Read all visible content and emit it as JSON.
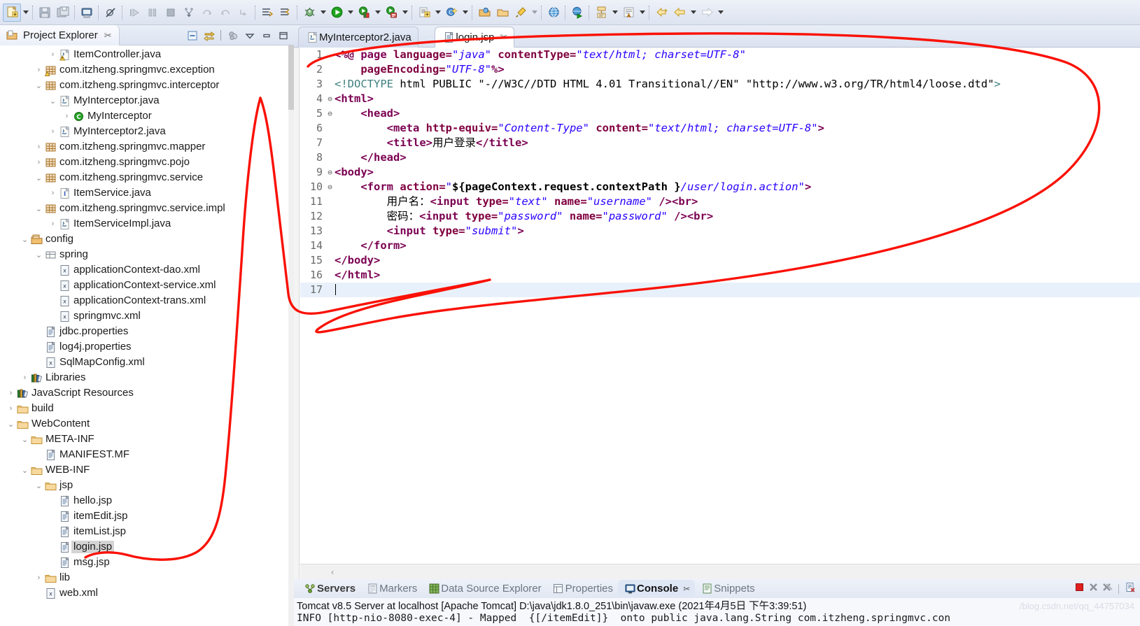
{
  "toolbar": {
    "buttons": [
      {
        "name": "new-wizard",
        "icon": "new-file-icon",
        "selected": true
      },
      {
        "name": "new-dropdown",
        "icon": "chevron-down-icon",
        "arrow": true
      },
      {
        "name": "save",
        "icon": "save-icon"
      },
      {
        "name": "save-all",
        "icon": "save-all-icon"
      },
      {
        "name": "print",
        "icon": "print-icon"
      },
      {
        "name": "toggle-breakpoint",
        "icon": "skip-breakpoints-icon"
      },
      {
        "name": "resume",
        "icon": "resume-icon"
      },
      {
        "name": "suspend",
        "icon": "suspend-icon"
      },
      {
        "name": "terminate",
        "icon": "terminate-icon"
      },
      {
        "name": "step-into",
        "icon": "step-into-icon"
      },
      {
        "name": "step-over",
        "icon": "step-over-icon"
      },
      {
        "name": "step-return",
        "icon": "step-return-icon"
      },
      {
        "name": "drop-to-frame",
        "icon": "drop-to-frame-icon"
      },
      {
        "name": "next-annotation",
        "icon": "next-annotation-icon"
      },
      {
        "name": "previous-annotation",
        "icon": "previous-annotation-icon"
      },
      {
        "name": "debug",
        "icon": "debug-bug-icon"
      },
      {
        "name": "run",
        "icon": "run-play-icon"
      },
      {
        "name": "run-external-tools",
        "icon": "external-tools-icon"
      },
      {
        "name": "run-server",
        "icon": "server-run-icon"
      },
      {
        "name": "new-java-project",
        "icon": "new-java-project-icon"
      },
      {
        "name": "new-class",
        "icon": "new-class-icon"
      },
      {
        "name": "open-type",
        "icon": "open-type-icon"
      },
      {
        "name": "search",
        "icon": "search-icon"
      },
      {
        "name": "open-task",
        "icon": "open-task-icon"
      },
      {
        "name": "web-browser",
        "icon": "globe-icon"
      },
      {
        "name": "web-preview",
        "icon": "globe-run-icon"
      },
      {
        "name": "new-jsp",
        "icon": "new-jsp-icon"
      },
      {
        "name": "new-html",
        "icon": "new-html-icon"
      },
      {
        "name": "back",
        "icon": "back-arrow-icon"
      },
      {
        "name": "forward",
        "icon": "forward-arrow-icon"
      }
    ]
  },
  "explorer": {
    "title": "Project Explorer",
    "close_glyph": "✂",
    "tools": [
      {
        "name": "collapse-all-icon"
      },
      {
        "name": "link-with-editor-icon"
      },
      {
        "name": "focus-on-active-task-icon"
      },
      {
        "name": "view-menu-icon"
      },
      {
        "name": "minimize-icon"
      },
      {
        "name": "maximize-icon"
      }
    ],
    "tree": [
      {
        "indent": 3,
        "twist": "collapsed",
        "icon": "java-file-warning-icon",
        "label": "ItemController.java"
      },
      {
        "indent": 2,
        "twist": "collapsed",
        "icon": "package-warning-icon",
        "label": "com.itzheng.springmvc.exception"
      },
      {
        "indent": 2,
        "twist": "expanded",
        "icon": "package-icon",
        "label": "com.itzheng.springmvc.interceptor"
      },
      {
        "indent": 3,
        "twist": "expanded",
        "icon": "java-file-icon",
        "label": "MyInterceptor.java"
      },
      {
        "indent": 4,
        "twist": "collapsed",
        "icon": "class-icon",
        "label": "MyInterceptor"
      },
      {
        "indent": 3,
        "twist": "collapsed",
        "icon": "java-file-icon",
        "label": "MyInterceptor2.java"
      },
      {
        "indent": 2,
        "twist": "collapsed",
        "icon": "package-icon",
        "label": "com.itzheng.springmvc.mapper"
      },
      {
        "indent": 2,
        "twist": "collapsed",
        "icon": "package-icon",
        "label": "com.itzheng.springmvc.pojo"
      },
      {
        "indent": 2,
        "twist": "expanded",
        "icon": "package-icon",
        "label": "com.itzheng.springmvc.service"
      },
      {
        "indent": 3,
        "twist": "collapsed",
        "icon": "interface-file-icon",
        "label": "ItemService.java"
      },
      {
        "indent": 2,
        "twist": "expanded",
        "icon": "package-icon",
        "label": "com.itzheng.springmvc.service.impl"
      },
      {
        "indent": 3,
        "twist": "collapsed",
        "icon": "java-file-icon",
        "label": "ItemServiceImpl.java"
      },
      {
        "indent": 1,
        "twist": "expanded",
        "icon": "source-folder-icon",
        "label": "config"
      },
      {
        "indent": 2,
        "twist": "expanded",
        "icon": "package-folder-icon",
        "label": "spring"
      },
      {
        "indent": 3,
        "twist": "none",
        "icon": "xml-file-icon",
        "label": "applicationContext-dao.xml"
      },
      {
        "indent": 3,
        "twist": "none",
        "icon": "xml-file-icon",
        "label": "applicationContext-service.xml"
      },
      {
        "indent": 3,
        "twist": "none",
        "icon": "xml-file-icon",
        "label": "applicationContext-trans.xml"
      },
      {
        "indent": 3,
        "twist": "none",
        "icon": "xml-file-icon",
        "label": "springmvc.xml"
      },
      {
        "indent": 2,
        "twist": "none",
        "icon": "properties-file-icon",
        "label": "jdbc.properties"
      },
      {
        "indent": 2,
        "twist": "none",
        "icon": "properties-file-icon",
        "label": "log4j.properties"
      },
      {
        "indent": 2,
        "twist": "none",
        "icon": "xml-file-icon",
        "label": "SqlMapConfig.xml"
      },
      {
        "indent": 1,
        "twist": "collapsed",
        "icon": "libraries-icon",
        "label": "Libraries"
      },
      {
        "indent": 0,
        "twist": "collapsed",
        "icon": "libraries-icon",
        "label": "JavaScript Resources"
      },
      {
        "indent": 0,
        "twist": "collapsed",
        "icon": "folder-icon",
        "label": "build"
      },
      {
        "indent": 0,
        "twist": "expanded",
        "icon": "folder-icon",
        "label": "WebContent"
      },
      {
        "indent": 1,
        "twist": "expanded",
        "icon": "folder-icon",
        "label": "META-INF"
      },
      {
        "indent": 2,
        "twist": "none",
        "icon": "manifest-file-icon",
        "label": "MANIFEST.MF"
      },
      {
        "indent": 1,
        "twist": "expanded",
        "icon": "folder-icon",
        "label": "WEB-INF"
      },
      {
        "indent": 2,
        "twist": "expanded",
        "icon": "folder-icon",
        "label": "jsp"
      },
      {
        "indent": 3,
        "twist": "none",
        "icon": "jsp-file-icon",
        "label": "hello.jsp"
      },
      {
        "indent": 3,
        "twist": "none",
        "icon": "jsp-file-icon",
        "label": "itemEdit.jsp"
      },
      {
        "indent": 3,
        "twist": "none",
        "icon": "jsp-file-icon",
        "label": "itemList.jsp"
      },
      {
        "indent": 3,
        "twist": "none",
        "icon": "jsp-file-icon",
        "label": "login.jsp",
        "selected": true
      },
      {
        "indent": 3,
        "twist": "none",
        "icon": "jsp-file-icon",
        "label": "msg.jsp"
      },
      {
        "indent": 2,
        "twist": "collapsed",
        "icon": "folder-icon",
        "label": "lib"
      },
      {
        "indent": 2,
        "twist": "none",
        "icon": "xml-file-icon",
        "label": "web.xml"
      }
    ]
  },
  "editor": {
    "tabs": [
      {
        "label": "MyInterceptor2.java",
        "icon": "java-file-icon",
        "active": false,
        "closable": false
      },
      {
        "label": "login.jsp",
        "icon": "jsp-file-icon",
        "active": true,
        "closable": true,
        "close_glyph": "✂"
      }
    ],
    "scroll_left_glyph": "‹",
    "lines": [
      {
        "no": "1",
        "fold": "",
        "segments": [
          {
            "t": "<%@ ",
            "c": "k-dir"
          },
          {
            "t": "page ",
            "c": "k-attr"
          },
          {
            "t": "language=",
            "c": "k-attr2"
          },
          {
            "t": "\"java\"",
            "c": "k-val"
          },
          {
            "t": " ",
            "c": "k-plain"
          },
          {
            "t": "contentType=",
            "c": "k-attr2"
          },
          {
            "t": "\"text/html; charset=UTF-8\"",
            "c": "k-val"
          }
        ]
      },
      {
        "no": "2",
        "fold": "",
        "segments": [
          {
            "t": "    ",
            "c": "k-plain"
          },
          {
            "t": "pageEncoding=",
            "c": "k-attr2"
          },
          {
            "t": "\"UTF-8\"",
            "c": "k-val"
          },
          {
            "t": "%>",
            "c": "k-dir"
          }
        ]
      },
      {
        "no": "3",
        "fold": "",
        "segments": [
          {
            "t": "<!DOCTYPE ",
            "c": "k-gray"
          },
          {
            "t": "html PUBLIC ",
            "c": "k-plain"
          },
          {
            "t": "\"-//W3C//DTD HTML 4.01 Transitional//EN\" \"http://www.w3.org/TR/html4/loose.dtd\"",
            "c": "k-plain"
          },
          {
            "t": ">",
            "c": "k-gray"
          }
        ]
      },
      {
        "no": "4",
        "fold": "⊖",
        "segments": [
          {
            "t": "<html>",
            "c": "k-ptag"
          }
        ]
      },
      {
        "no": "5",
        "fold": "⊖",
        "segments": [
          {
            "t": "    <head>",
            "c": "k-ptag"
          }
        ]
      },
      {
        "no": "6",
        "fold": "",
        "segments": [
          {
            "t": "        ",
            "c": "k-plain"
          },
          {
            "t": "<meta ",
            "c": "k-ptag"
          },
          {
            "t": "http-equiv=",
            "c": "k-attr2"
          },
          {
            "t": "\"Content-Type\"",
            "c": "k-val"
          },
          {
            "t": " ",
            "c": "k-plain"
          },
          {
            "t": "content=",
            "c": "k-attr2"
          },
          {
            "t": "\"text/html; charset=UTF-8\"",
            "c": "k-val"
          },
          {
            "t": ">",
            "c": "k-ptag"
          }
        ]
      },
      {
        "no": "7",
        "fold": "",
        "segments": [
          {
            "t": "        ",
            "c": "k-plain"
          },
          {
            "t": "<title>",
            "c": "k-ptag"
          },
          {
            "t": "用户登录",
            "c": "k-txt"
          },
          {
            "t": "</title>",
            "c": "k-ptag"
          }
        ]
      },
      {
        "no": "8",
        "fold": "",
        "segments": [
          {
            "t": "    </head>",
            "c": "k-ptag"
          }
        ]
      },
      {
        "no": "9",
        "fold": "⊖",
        "segments": [
          {
            "t": "<body>",
            "c": "k-ptag"
          }
        ]
      },
      {
        "no": "10",
        "fold": "⊖",
        "segments": [
          {
            "t": "    ",
            "c": "k-plain"
          },
          {
            "t": "<form ",
            "c": "k-ptag"
          },
          {
            "t": "action=",
            "c": "k-attr2"
          },
          {
            "t": "\"",
            "c": "k-val"
          },
          {
            "t": "${pageContext.request.contextPath }",
            "c": "k-el"
          },
          {
            "t": "/user/login.action\"",
            "c": "k-val"
          },
          {
            "t": ">",
            "c": "k-ptag"
          }
        ]
      },
      {
        "no": "11",
        "fold": "",
        "segments": [
          {
            "t": "        ",
            "c": "k-plain"
          },
          {
            "t": "用户名：",
            "c": "k-txt"
          },
          {
            "t": "<input ",
            "c": "k-ptag"
          },
          {
            "t": "type=",
            "c": "k-attr2"
          },
          {
            "t": "\"text\"",
            "c": "k-val"
          },
          {
            "t": " ",
            "c": "k-plain"
          },
          {
            "t": "name=",
            "c": "k-attr2"
          },
          {
            "t": "\"username\"",
            "c": "k-val"
          },
          {
            "t": " />",
            "c": "k-ptag"
          },
          {
            "t": "<br>",
            "c": "k-ptag"
          }
        ]
      },
      {
        "no": "12",
        "fold": "",
        "segments": [
          {
            "t": "        ",
            "c": "k-plain"
          },
          {
            "t": "密码：",
            "c": "k-txt"
          },
          {
            "t": "<input ",
            "c": "k-ptag"
          },
          {
            "t": "type=",
            "c": "k-attr2"
          },
          {
            "t": "\"password\"",
            "c": "k-val"
          },
          {
            "t": " ",
            "c": "k-plain"
          },
          {
            "t": "name=",
            "c": "k-attr2"
          },
          {
            "t": "\"password\"",
            "c": "k-val"
          },
          {
            "t": " />",
            "c": "k-ptag"
          },
          {
            "t": "<br>",
            "c": "k-ptag"
          }
        ]
      },
      {
        "no": "13",
        "fold": "",
        "segments": [
          {
            "t": "        ",
            "c": "k-plain"
          },
          {
            "t": "<input ",
            "c": "k-ptag"
          },
          {
            "t": "type=",
            "c": "k-attr2"
          },
          {
            "t": "\"submit\"",
            "c": "k-val"
          },
          {
            "t": ">",
            "c": "k-ptag"
          }
        ]
      },
      {
        "no": "14",
        "fold": "",
        "segments": [
          {
            "t": "    </form>",
            "c": "k-ptag"
          }
        ]
      },
      {
        "no": "15",
        "fold": "",
        "segments": [
          {
            "t": "</body>",
            "c": "k-ptag"
          }
        ]
      },
      {
        "no": "16",
        "fold": "",
        "segments": [
          {
            "t": "</html>",
            "c": "k-ptag"
          }
        ]
      },
      {
        "no": "17",
        "fold": "",
        "current": true,
        "segments": []
      }
    ]
  },
  "bottom": {
    "tabs": [
      {
        "label": "Servers",
        "icon": "servers-icon",
        "active": false,
        "bold": true
      },
      {
        "label": "Markers",
        "icon": "markers-icon",
        "active": false
      },
      {
        "label": "Data Source Explorer",
        "icon": "data-source-icon",
        "active": false
      },
      {
        "label": "Properties",
        "icon": "properties-icon",
        "active": false
      },
      {
        "label": "Console",
        "icon": "console-icon",
        "active": true,
        "closable": true,
        "close_glyph": "✂"
      },
      {
        "label": "Snippets",
        "icon": "snippets-icon",
        "active": false
      }
    ],
    "tools": [
      {
        "name": "terminate-icon"
      },
      {
        "name": "remove-launch-icon"
      },
      {
        "name": "remove-all-terminated-icon"
      },
      {
        "name": "clear-console-icon"
      }
    ],
    "console_header": "Tomcat v8.5 Server at localhost [Apache Tomcat] D:\\java\\jdk1.8.0_251\\bin\\javaw.exe (2021年4月5日 下午3:39:51)",
    "console_line": "INFO [http-nio-8080-exec-4] - Mapped  {[/itemEdit]}  onto public java.lang.String com.itzheng.springmvc.con",
    "watermark": "/blog.csdn.net/qq_44757034"
  },
  "colors": {
    "accent_red": "#fa1105",
    "tab_active_bg": "#ffffff",
    "selection": "#d4d4d4",
    "current_line": "#e8f1fb"
  }
}
